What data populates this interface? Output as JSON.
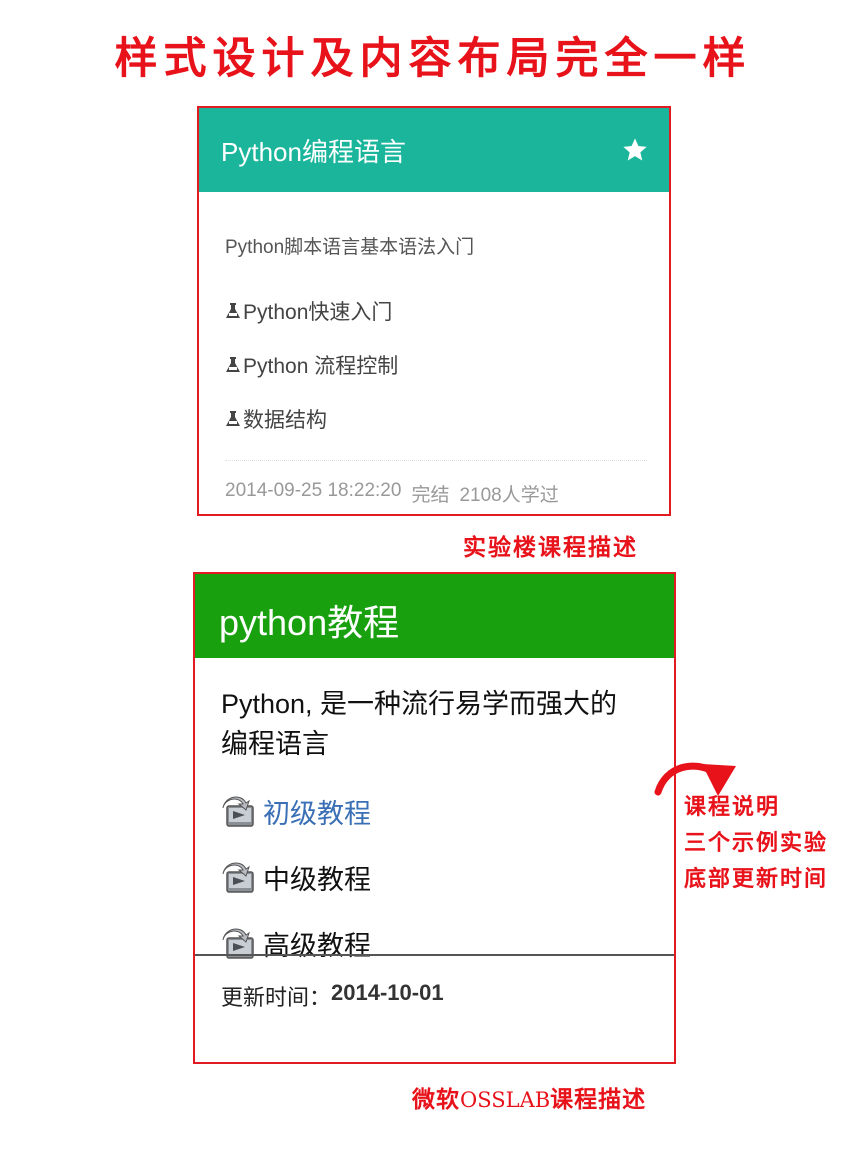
{
  "headline": "样式设计及内容布局完全一样",
  "shiyanlou_card": {
    "title": "Python编程语言",
    "favorite_icon": "star-icon",
    "description": "Python脚本语言基本语法入门",
    "labs": [
      "Python快速入门",
      "Python 流程控制",
      "数据结构"
    ],
    "lab_icon": "flask-icon",
    "footer": {
      "datetime": "2014-09-25 18:22:20",
      "status": "完结",
      "learners": "2108人学过"
    },
    "caption": "实验楼课程描述",
    "header_color": "#1bb59c"
  },
  "osslab_card": {
    "title": "python教程",
    "description": "Python, 是一种流行易学而强大的编程语言",
    "labs": [
      "初级教程",
      "中级教程",
      "高级教程"
    ],
    "lab_icon": "book-arrow-icon",
    "footer": {
      "label": "更新时间：",
      "date": "2014-10-01"
    },
    "caption_prefix": "微软",
    "caption_mono": "OSSLAB",
    "caption_suffix": "课程描述",
    "header_color": "#18a00f"
  },
  "annotations": {
    "arrow_icon": "curved-arrow-icon",
    "notes": [
      "课程说明",
      "三个示例实验",
      "底部更新时间"
    ]
  },
  "accent_color": "#e8121a"
}
